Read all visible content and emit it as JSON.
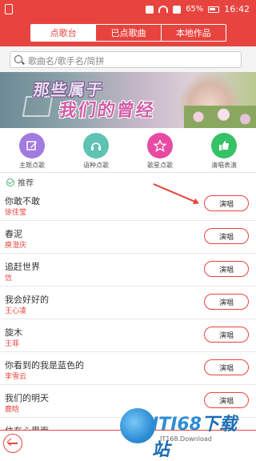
{
  "status_bar": {
    "battery": "65%",
    "time": "16:42"
  },
  "tabs": [
    {
      "label": "点歌台",
      "active": true
    },
    {
      "label": "已点歌曲",
      "active": false
    },
    {
      "label": "本地作品",
      "active": false
    }
  ],
  "search": {
    "placeholder": "歌曲名/歌手名/简拼"
  },
  "banner": {
    "line1": "那些属于",
    "line2": "我们的曾经"
  },
  "categories": [
    {
      "label": "主题点歌",
      "icon": "edit-icon",
      "color": "#a17be0"
    },
    {
      "label": "语种点歌",
      "icon": "headphones-icon",
      "color": "#5ec3b3"
    },
    {
      "label": "歌星点歌",
      "icon": "star-icon",
      "color": "#e74aa3"
    },
    {
      "label": "清唱表演",
      "icon": "thumbs-up-icon",
      "color": "#37c268"
    }
  ],
  "recommend_label": "推荐",
  "songs": [
    {
      "title": "你敢不敢",
      "artist": "徐佳莹",
      "action": "演唱"
    },
    {
      "title": "春泥",
      "artist": "庾澄庆",
      "action": "演唱"
    },
    {
      "title": "追赶世界",
      "artist": "信",
      "action": "演唱"
    },
    {
      "title": "我会好好的",
      "artist": "王心凌",
      "action": "演唱"
    },
    {
      "title": "旋木",
      "artist": "王菲",
      "action": "演唱"
    },
    {
      "title": "你看到的我是蓝色的",
      "artist": "李雪云",
      "action": "演唱"
    },
    {
      "title": "我们的明天",
      "artist": "鹿晗",
      "action": "演唱"
    },
    {
      "title": "住在心里面",
      "artist": "",
      "action": ""
    }
  ],
  "watermark": {
    "brand": "ITI68",
    "brand_cn": "下载站",
    "sub": "IT168.Download"
  },
  "colors": {
    "accent": "#e8443f"
  }
}
